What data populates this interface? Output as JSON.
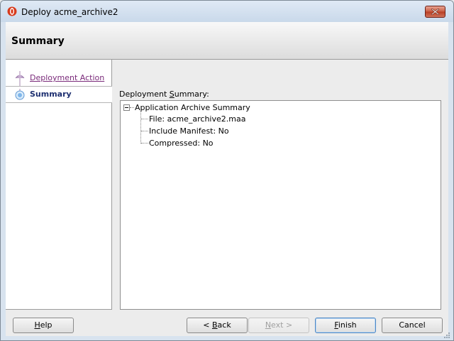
{
  "window": {
    "title": "Deploy acme_archive2",
    "icon": "oracle-red-icon",
    "close_icon": "close-icon"
  },
  "header": {
    "title": "Summary"
  },
  "nav": {
    "items": [
      {
        "label": "Deployment Action",
        "state": "visited"
      },
      {
        "label": "Summary",
        "state": "current"
      }
    ]
  },
  "content": {
    "summary_label_pre": "Deployment ",
    "summary_label_accel": "S",
    "summary_label_post": "ummary:",
    "tree": {
      "root": "Application Archive Summary",
      "children": [
        "File:  acme_archive2.maa",
        "Include Manifest:  No",
        "Compressed:  No"
      ]
    }
  },
  "buttons": {
    "help": {
      "accel": "H",
      "rest": "elp"
    },
    "back": {
      "pre": "< ",
      "accel": "B",
      "rest": "ack"
    },
    "next": {
      "accel": "N",
      "rest": "ext >"
    },
    "finish": {
      "accel": "F",
      "rest": "inish"
    },
    "cancel": {
      "label": "Cancel"
    }
  },
  "colors": {
    "visited_link": "#7a2a7a",
    "current_step": "#1d2f70",
    "close_button": "#c75a40"
  }
}
